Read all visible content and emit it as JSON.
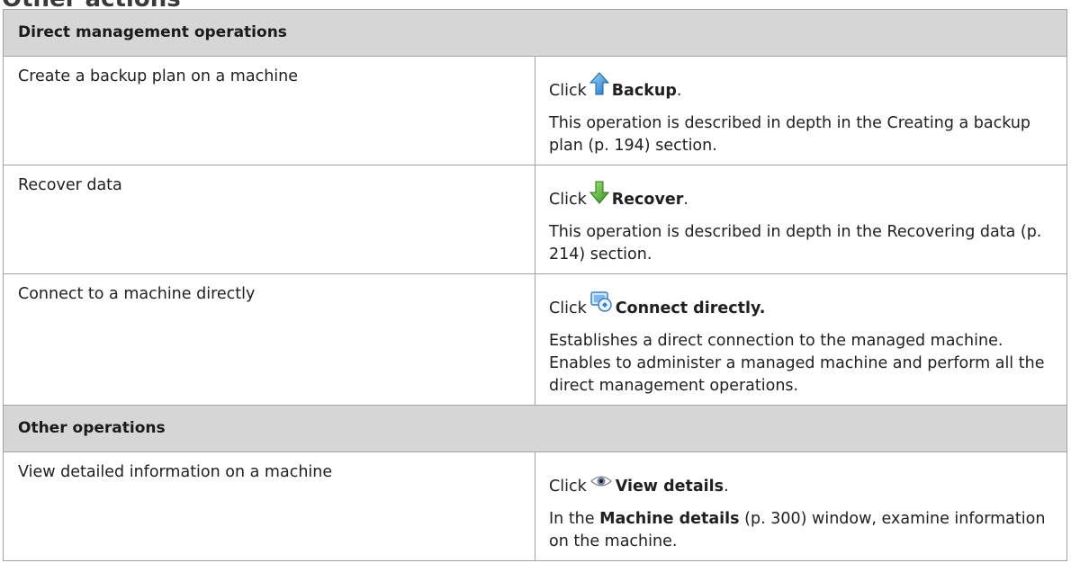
{
  "heading": "Other actions",
  "sections": [
    {
      "title": "Direct management operations",
      "rows": [
        {
          "label": "Create a backup plan on a machine",
          "click_word": "Click",
          "action": "Backup",
          "after": ".",
          "icon": "backup-arrow-up-icon",
          "description": "This operation is described in depth in the Creating a backup plan (p. 194) section."
        },
        {
          "label": "Recover data",
          "click_word": "Click",
          "action": "Recover",
          "after": ".",
          "icon": "recover-arrow-down-icon",
          "description": "This operation is described in depth in the Recovering data (p. 214) section."
        },
        {
          "label": "Connect to a machine directly",
          "click_word": "Click",
          "action": "Connect directly.",
          "after": "",
          "icon": "connect-machine-icon",
          "description": "Establishes a direct connection to the managed machine. Enables to administer a managed machine and perform all the direct management operations."
        }
      ]
    },
    {
      "title": "Other operations",
      "rows": [
        {
          "label": "View detailed information on a machine",
          "click_word": "Click",
          "action": "View details",
          "after": ".",
          "icon": "view-details-eye-icon",
          "description_prefix": "In the",
          "description_bold": "Machine details",
          "description_suffix": "(p. 300) window, examine information on the machine."
        }
      ]
    }
  ],
  "colors": {
    "header_bg": "#d6d6d6",
    "border": "#a3a3a3",
    "backup_icon": "#2f8fd8",
    "recover_icon": "#3aa63a"
  }
}
